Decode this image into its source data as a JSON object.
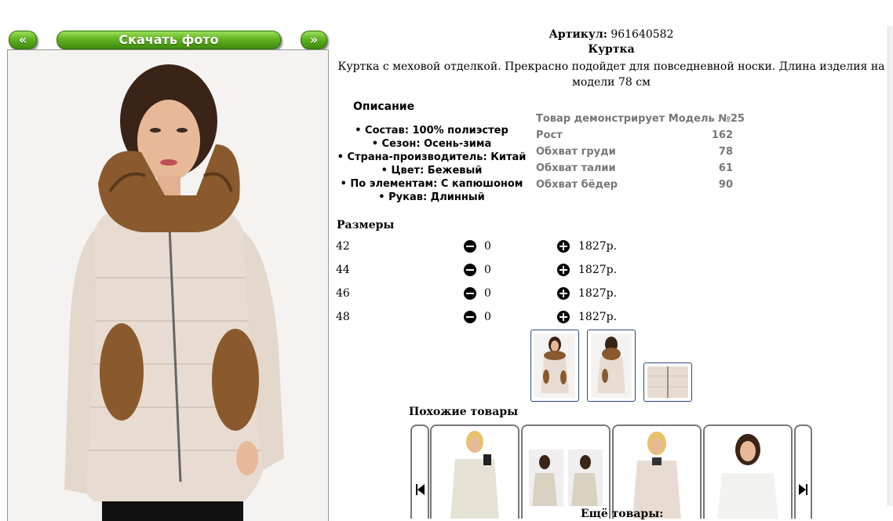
{
  "nav": {
    "prev_label": "«",
    "download_label": "Скачать фото",
    "next_label": "»"
  },
  "product": {
    "article_label": "Артикул:",
    "article_value": "961640582",
    "name": "Куртка",
    "summary": "Куртка с меховой отделкой. Прекрасно подойдет для повседневной носки. Длина изделия на модели 78 см"
  },
  "description": {
    "heading": "Описание",
    "items": [
      "• Состав: 100% полиэстер",
      "• Сезон: Осень-зима",
      "• Страна-производитель: Китай",
      "• Цвет: Бежевый",
      "• По элементам: С капюшоном",
      "• Рукав: Длинный"
    ]
  },
  "model": {
    "heading": "Товар демонстрирует Модель №25",
    "rows": [
      {
        "label": "Рост",
        "value": "162"
      },
      {
        "label": "Обхват груди",
        "value": "78"
      },
      {
        "label": "Обхват талии",
        "value": "61"
      },
      {
        "label": "Обхват бёдер",
        "value": "90"
      }
    ]
  },
  "sizes": {
    "heading": "Размеры",
    "rows": [
      {
        "size": "42",
        "qty": "0",
        "price": "1827р."
      },
      {
        "size": "44",
        "qty": "0",
        "price": "1827р."
      },
      {
        "size": "46",
        "qty": "0",
        "price": "1827р."
      },
      {
        "size": "48",
        "qty": "0",
        "price": "1827р."
      }
    ]
  },
  "similar": {
    "heading": "Похожие товары"
  },
  "more": {
    "heading": "Ещё товары:"
  },
  "colors": {
    "green_button": "#5fb21f",
    "jacket": "#e8dcd2",
    "fur": "#8a5a2e",
    "thumb_border": "#2a4a7a"
  }
}
